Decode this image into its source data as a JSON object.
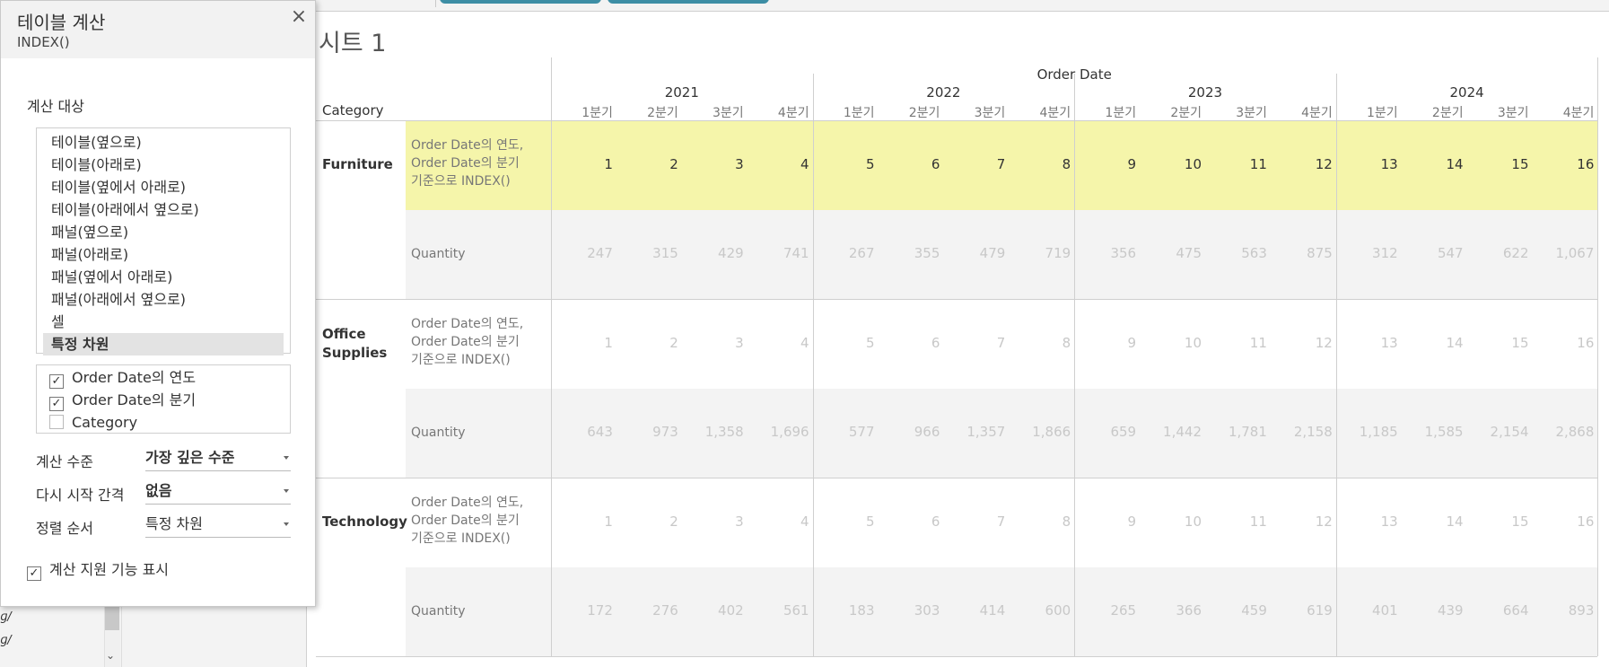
{
  "dialog": {
    "title": "테이블 계산",
    "subtitle": "INDEX()",
    "close_icon": "close-icon",
    "compute_using_label": "계산 대상",
    "compute_using_options": [
      "테이블(옆으로)",
      "테이블(아래로)",
      "테이블(옆에서 아래로)",
      "테이블(아래에서 옆으로)",
      "패널(옆으로)",
      "패널(아래로)",
      "패널(옆에서 아래로)",
      "패널(아래에서 옆으로)",
      "셀",
      "특정 차원"
    ],
    "selected_option": "특정 차원",
    "dimensions": [
      {
        "label": "Order Date의 연도",
        "checked": true
      },
      {
        "label": "Order Date의 분기",
        "checked": true
      },
      {
        "label": "Category",
        "checked": false
      }
    ],
    "level_label": "계산 수준",
    "level_value": "가장 깊은 수준",
    "restart_label": "다시 시작 간격",
    "restart_value": "없음",
    "sort_label": "정렬 순서",
    "sort_value": "특정 차원",
    "assist_label": "계산 지원 기능 표시",
    "assist_checked": true
  },
  "sheet": {
    "title": "시트 1",
    "column_header": "Order Date",
    "row_header": "Category",
    "years": [
      "2021",
      "2022",
      "2023",
      "2024"
    ],
    "quarters": [
      "1분기",
      "2분기",
      "3분기",
      "4분기"
    ],
    "categories": [
      "Furniture",
      "Office Supplies",
      "Technology"
    ],
    "category_lines": [
      [
        "Furniture"
      ],
      [
        "Office",
        "Supplies"
      ],
      [
        "Technology"
      ]
    ],
    "measure_index_lines": [
      "Order Date의 연도,",
      "Order Date의 분기",
      "기준으로 INDEX()"
    ],
    "measure_quantity": "Quantity",
    "index_values": [
      "1",
      "2",
      "3",
      "4",
      "5",
      "6",
      "7",
      "8",
      "9",
      "10",
      "11",
      "12",
      "13",
      "14",
      "15",
      "16"
    ],
    "quantity_values": [
      [
        "247",
        "315",
        "429",
        "741",
        "267",
        "355",
        "479",
        "719",
        "356",
        "475",
        "563",
        "875",
        "312",
        "547",
        "622",
        "1,067"
      ],
      [
        "643",
        "973",
        "1,358",
        "1,696",
        "577",
        "966",
        "1,357",
        "1,866",
        "659",
        "1,442",
        "1,781",
        "2,158",
        "1,185",
        "1,585",
        "2,154",
        "2,868"
      ],
      [
        "172",
        "276",
        "402",
        "561",
        "183",
        "303",
        "414",
        "600",
        "265",
        "366",
        "459",
        "619",
        "401",
        "439",
        "664",
        "893"
      ]
    ],
    "highlight_color": "#f5f5aa",
    "band_color": "#f3f3f3"
  },
  "left_panel": {
    "item_1": "ɡ/",
    "item_2": "ɡ/"
  },
  "colors": {
    "accent": "#3d8ea5"
  }
}
